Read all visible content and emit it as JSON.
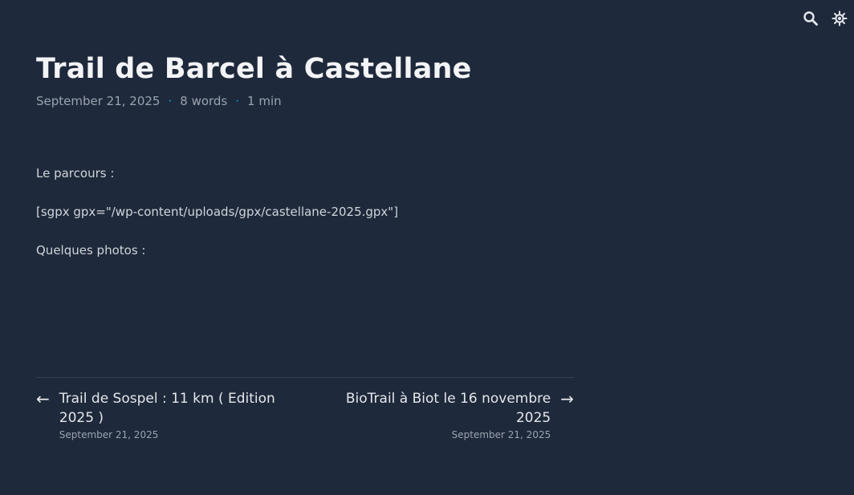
{
  "header": {
    "search_icon": "search-icon",
    "theme_icon": "sun-icon"
  },
  "post": {
    "title": "Trail de Barcel à Castellane",
    "date": "September 21, 2025",
    "separator": "·",
    "words": "8 words",
    "reading_time": "1 min",
    "paragraphs": [
      "Le parcours :",
      "[sgpx gpx=\"/wp-content/uploads/gpx/castellane-2025.gpx\"]",
      "Quelques photos :"
    ]
  },
  "navigation": {
    "prev": {
      "arrow": "←",
      "title": "Trail de Sospel : 11 km ( Edition 2025 )",
      "date": "September 21, 2025"
    },
    "next": {
      "arrow": "→",
      "title": "BioTrail à Biot le 16 novembre 2025",
      "date": "September 21, 2025"
    }
  },
  "colors": {
    "background": "#1e293b",
    "accent": "#0ea5e9",
    "title": "#f3f4f6"
  }
}
